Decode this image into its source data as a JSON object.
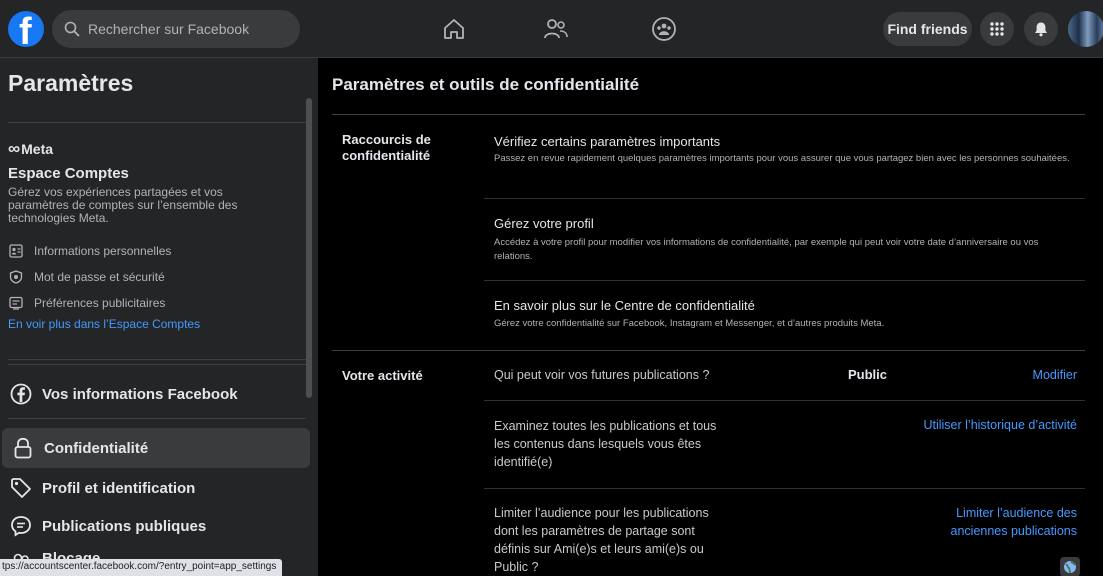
{
  "topbar": {
    "logo_letter": "f",
    "search_placeholder": "Rechercher sur Facebook",
    "find_friends": "Find friends"
  },
  "sidebar": {
    "title": "Paramètres",
    "meta": {
      "logo": "Meta",
      "heading": "Espace Comptes",
      "description": "Gérez vos expériences partagées et vos paramètres de comptes sur l’ensemble des technologies Meta.",
      "items": [
        {
          "label": "Informations personnelles",
          "icon": "id-card-icon"
        },
        {
          "label": "Mot de passe et sécurité",
          "icon": "shield-icon"
        },
        {
          "label": "Préférences publicitaires",
          "icon": "ad-preferences-icon"
        }
      ],
      "link": "En voir plus dans l’Espace Comptes"
    },
    "nav": [
      {
        "label": "Vos informations Facebook",
        "icon": "facebook-icon"
      },
      {
        "label": "Confidentialité",
        "icon": "lock-icon"
      },
      {
        "label": "Profil et identification",
        "icon": "tag-icon"
      },
      {
        "label": "Publications publiques",
        "icon": "chat-bubble-icon"
      },
      {
        "label": "Blocage",
        "icon": "block-icon"
      }
    ],
    "status_url": "tps://accountscenter.facebook.com/?entry_point=app_settings"
  },
  "main": {
    "title": "Paramètres et outils de confidentialité",
    "shortcuts": {
      "label": "Raccourcis de confidentialité",
      "entries": [
        {
          "title": "Vérifiez certains paramètres importants",
          "desc": "Passez en revue rapidement quelques paramètres importants pour vous assurer que vous partagez bien avec les personnes souhaitées."
        },
        {
          "title": "Gérez votre profil",
          "desc": "Accédez à votre profil pour modifier vos informations de confidentialité, par exemple qui peut voir votre date d’anniversaire ou vos relations."
        },
        {
          "title": "En savoir plus sur le Centre de confidentialité",
          "desc": "Gérez votre confidentialité sur Facebook, Instagram et Messenger, et d’autres produits Meta."
        }
      ]
    },
    "activity": {
      "label": "Votre activité",
      "rows": [
        {
          "text": "Qui peut voir vos futures publications ?",
          "value": "Public",
          "link": "Modifier"
        },
        {
          "text": "Examinez toutes les publications et tous les contenus dans lesquels vous êtes identifié(e)",
          "link": "Utiliser l’historique d’activité"
        },
        {
          "text": "Limiter l’audience pour les publications dont les paramètres de partage sont définis sur Ami(e)s et leurs ami(e)s ou Public ?",
          "link": "Limiter l’audience des anciennes publications"
        }
      ]
    }
  },
  "colors": {
    "brand": "#1877f2",
    "link": "#4599ff",
    "sidebar_bg": "#242526",
    "main_bg": "#000000"
  }
}
